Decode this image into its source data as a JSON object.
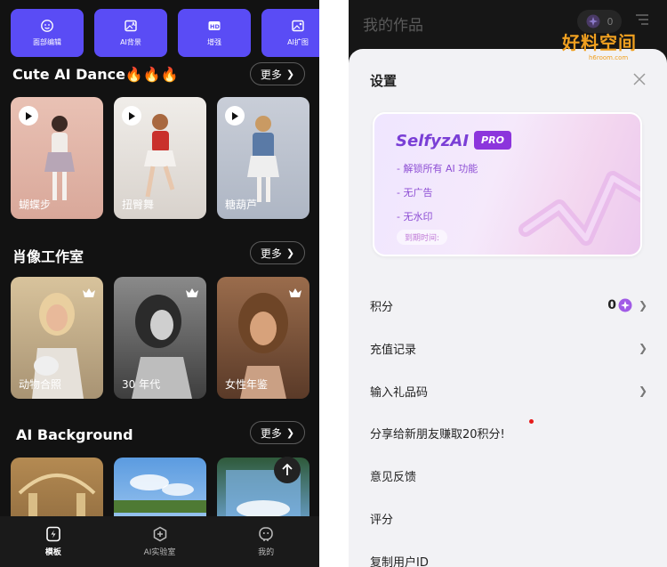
{
  "left": {
    "tools": [
      {
        "label": "面部编辑",
        "icon": "face-edit-icon"
      },
      {
        "label": "AI背景",
        "icon": "ai-background-icon"
      },
      {
        "label": "增强",
        "icon": "hd-enhance-icon"
      },
      {
        "label": "AI扩图",
        "icon": "ai-expand-icon"
      }
    ],
    "sections": [
      {
        "title": "Cute AI Dance🔥🔥🔥",
        "more": "更多",
        "cards": [
          {
            "caption": "蝴蝶步"
          },
          {
            "caption": "扭臀舞"
          },
          {
            "caption": "糖葫芦"
          }
        ]
      },
      {
        "title": "肖像工作室",
        "more": "更多",
        "cards": [
          {
            "caption": "动物合照"
          },
          {
            "caption": "30 年代"
          },
          {
            "caption": "女性年鉴"
          }
        ]
      },
      {
        "title": "AI Background",
        "more": "更多",
        "cards": []
      }
    ],
    "tabs": [
      {
        "label": "模板",
        "icon": "template-icon",
        "active": true
      },
      {
        "label": "AI实验室",
        "icon": "ai-lab-icon",
        "active": false
      },
      {
        "label": "我的",
        "icon": "profile-icon",
        "active": false
      }
    ]
  },
  "right": {
    "header_title": "我的作品",
    "coins": "0",
    "watermark": {
      "main": "好料空间",
      "sub": "h6room.com"
    },
    "sheet": {
      "title": "设置",
      "pro": {
        "brand": "SelfyzAI",
        "badge": "PRO",
        "features": [
          "- 解锁所有 AI 功能",
          "- 无广告",
          "- 无水印"
        ],
        "expire": "到期时间:"
      },
      "items": [
        {
          "label": "积分",
          "value": "0",
          "chevron": true
        },
        {
          "label": "充值记录",
          "chevron": true
        },
        {
          "label": "输入礼品码",
          "chevron": true
        },
        {
          "label": "分享给新朋友赚取20积分!",
          "chevron": false
        },
        {
          "label": "意见反馈",
          "chevron": false
        },
        {
          "label": "评分",
          "chevron": false
        },
        {
          "label": "复制用户ID",
          "chevron": false
        }
      ]
    }
  },
  "colors": {
    "accent": "#5a4cf5",
    "pro_purple": "#8c35dc",
    "notification": "#e61a1a"
  }
}
